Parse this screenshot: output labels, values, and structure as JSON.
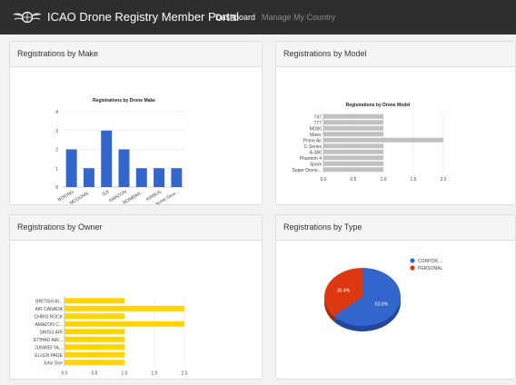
{
  "app": {
    "title": "ICAO Drone Registry Member Portal",
    "nav": [
      {
        "label": "Dashboard",
        "active": true
      },
      {
        "label": "Manage My Country",
        "active": false
      }
    ]
  },
  "colors": {
    "navbar": "#2e2e2e",
    "make_bar": "#3366cc",
    "model_bar": "#c0c0c0",
    "owner_bar": "#ffd400",
    "corporate": "#3366cc",
    "personal": "#dc3912"
  },
  "panels": {
    "make": {
      "heading": "Registrations by Make"
    },
    "model": {
      "heading": "Registrations by Model"
    },
    "owner": {
      "heading": "Registrations by Owner"
    },
    "type": {
      "heading": "Registrations by Type"
    }
  },
  "chart_data": [
    {
      "id": "make",
      "type": "bar",
      "title": "Registrations by Drone Make",
      "categories": [
        "BOEING",
        "MCDONN...",
        "DJI",
        "AMAZON",
        "BOMBAR...",
        "AIRBUS",
        "Acme Dron..."
      ],
      "values": [
        2,
        1,
        3,
        2,
        1,
        1,
        1
      ],
      "yticks": [
        "0",
        "1",
        "2",
        "3",
        "4"
      ],
      "ylim": [
        0,
        4
      ],
      "grid": true
    },
    {
      "id": "model",
      "type": "bar",
      "orientation": "horizontal",
      "title": "Registrations by Drone Model",
      "categories": [
        "747",
        "777",
        "MD80",
        "Mavic",
        "Prime Air",
        "C-Series",
        "A-380",
        "Phantom 4",
        "Spark",
        "Super Drone..."
      ],
      "values": [
        1,
        1,
        1,
        1,
        2,
        1,
        1,
        1,
        1,
        1
      ],
      "xticks": [
        "0.0",
        "0.5",
        "1.0",
        "1.5",
        "2.0"
      ],
      "xlim": [
        0,
        2
      ],
      "grid": true
    },
    {
      "id": "owner",
      "type": "bar",
      "orientation": "horizontal",
      "categories": [
        "BRITISH AI...",
        "AIR CANADA",
        "CHRIS ROCK",
        "AMAZON C...",
        "SWISS AIR",
        "ETIHAD AIR...",
        "JUNWEI YA...",
        "ELLEN PAGE",
        "John Doe"
      ],
      "values": [
        1,
        2,
        1,
        2,
        1,
        1,
        1,
        1,
        1
      ],
      "xticks": [
        "0.0",
        "0.5",
        "1.0",
        "1.5",
        "2.0"
      ],
      "xlim": [
        0,
        2
      ],
      "grid": true
    },
    {
      "id": "type",
      "type": "pie",
      "categories": [
        "CORPOR...",
        "PERSONAL"
      ],
      "values": [
        63.6,
        36.4
      ],
      "labels": [
        "63.6%",
        "36.4%"
      ],
      "legend": "right"
    }
  ]
}
